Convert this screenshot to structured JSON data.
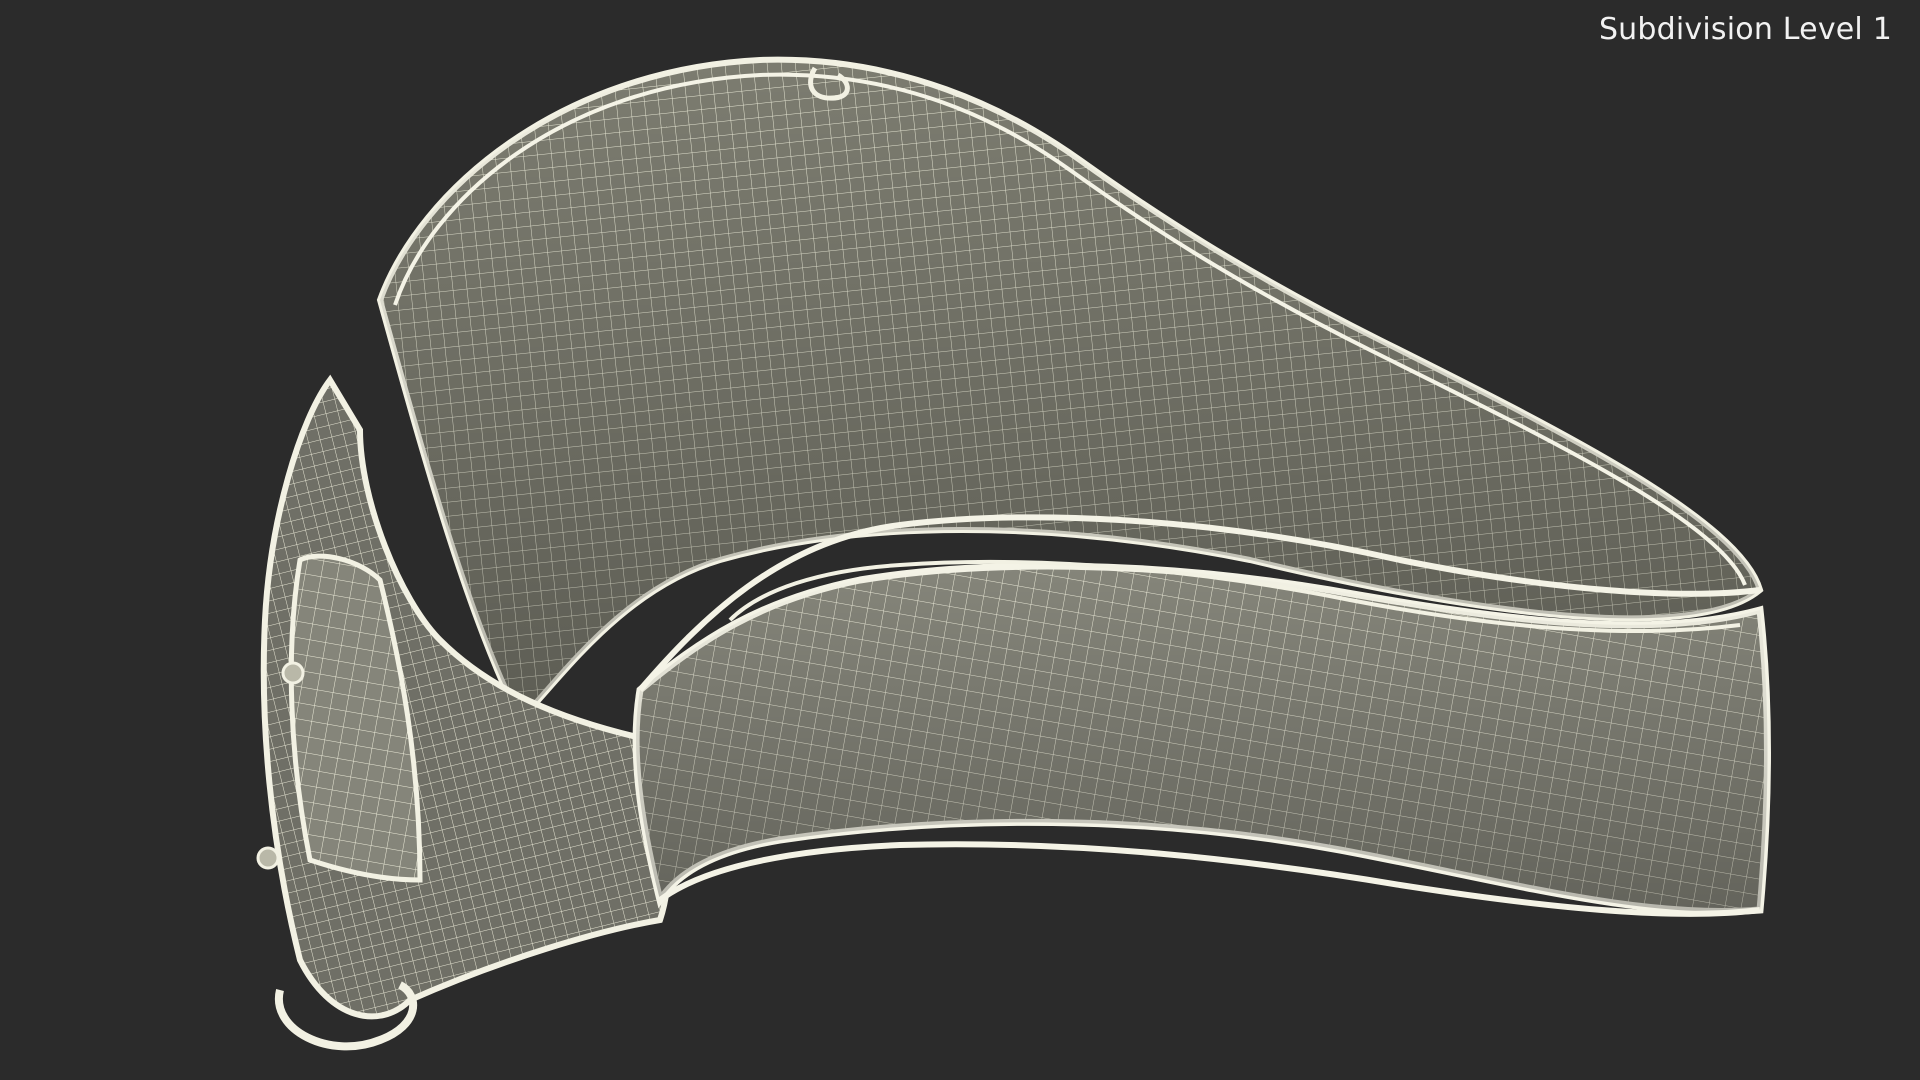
{
  "viewport": {
    "label": "Subdivision Level 1",
    "background_color": "#2b2b2b",
    "model_color": "#7f7f74",
    "wire_color": "#eeeedd"
  },
  "model": {
    "name": "3D wireframe belt support model",
    "icon": "wireframe-mesh"
  }
}
